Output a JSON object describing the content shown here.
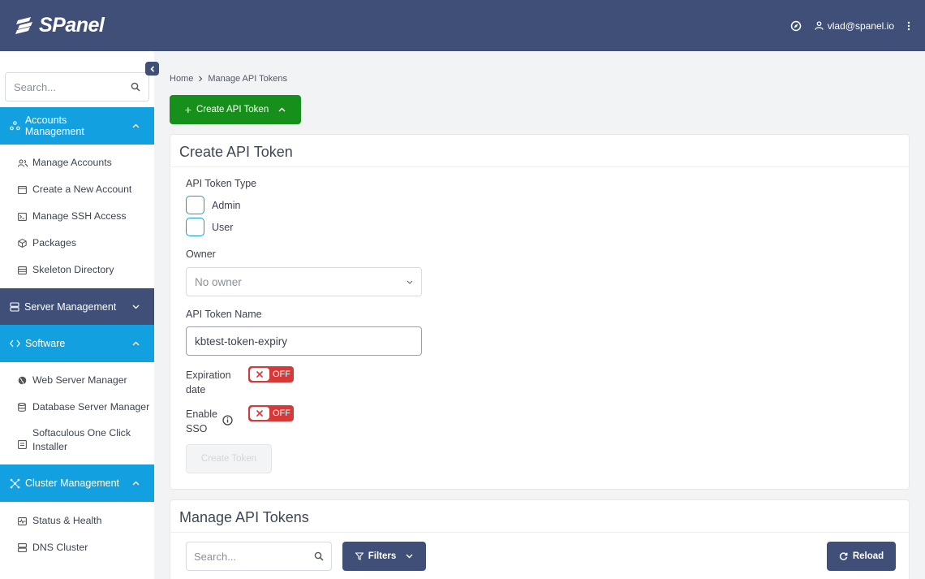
{
  "header": {
    "brand": "SPanel",
    "user_email": "vlad@spanel.io"
  },
  "sidebar": {
    "search_placeholder": "Search...",
    "sections": [
      {
        "label": "Accounts Management",
        "items": [
          "Manage Accounts",
          "Create a New Account",
          "Manage SSH Access",
          "Packages",
          "Skeleton Directory"
        ]
      },
      {
        "label": "Server Management"
      },
      {
        "label": "Software",
        "items": [
          "Web Server Manager",
          "Database Server Manager",
          "Softaculous One Click Installer"
        ]
      },
      {
        "label": "Cluster Management",
        "items": [
          "Status & Health",
          "DNS Cluster"
        ]
      }
    ]
  },
  "breadcrumb": {
    "home": "Home",
    "current": "Manage API Tokens"
  },
  "create_button": "Create API Token",
  "create_card": {
    "title": "Create API Token",
    "type_label": "API Token Type",
    "type_options": [
      "Admin",
      "User"
    ],
    "owner_label": "Owner",
    "owner_value": "No owner",
    "name_label": "API Token Name",
    "name_value": "kbtest-token-expiry",
    "expiration_label_1": "Expiration",
    "expiration_label_2": "date",
    "expiration_state": "OFF",
    "sso_label_1": "Enable",
    "sso_label_2": "SSO",
    "sso_state": "OFF",
    "submit_label": "Create Token"
  },
  "manage_card": {
    "title": "Manage API Tokens",
    "search_placeholder": "Search...",
    "filters_label": "Filters",
    "reload_label": "Reload"
  },
  "colors": {
    "topbar": "#3f4f78",
    "sidebar_active": "#12a0e0",
    "create_button": "#16901b",
    "toggle_off": "#d73838"
  }
}
